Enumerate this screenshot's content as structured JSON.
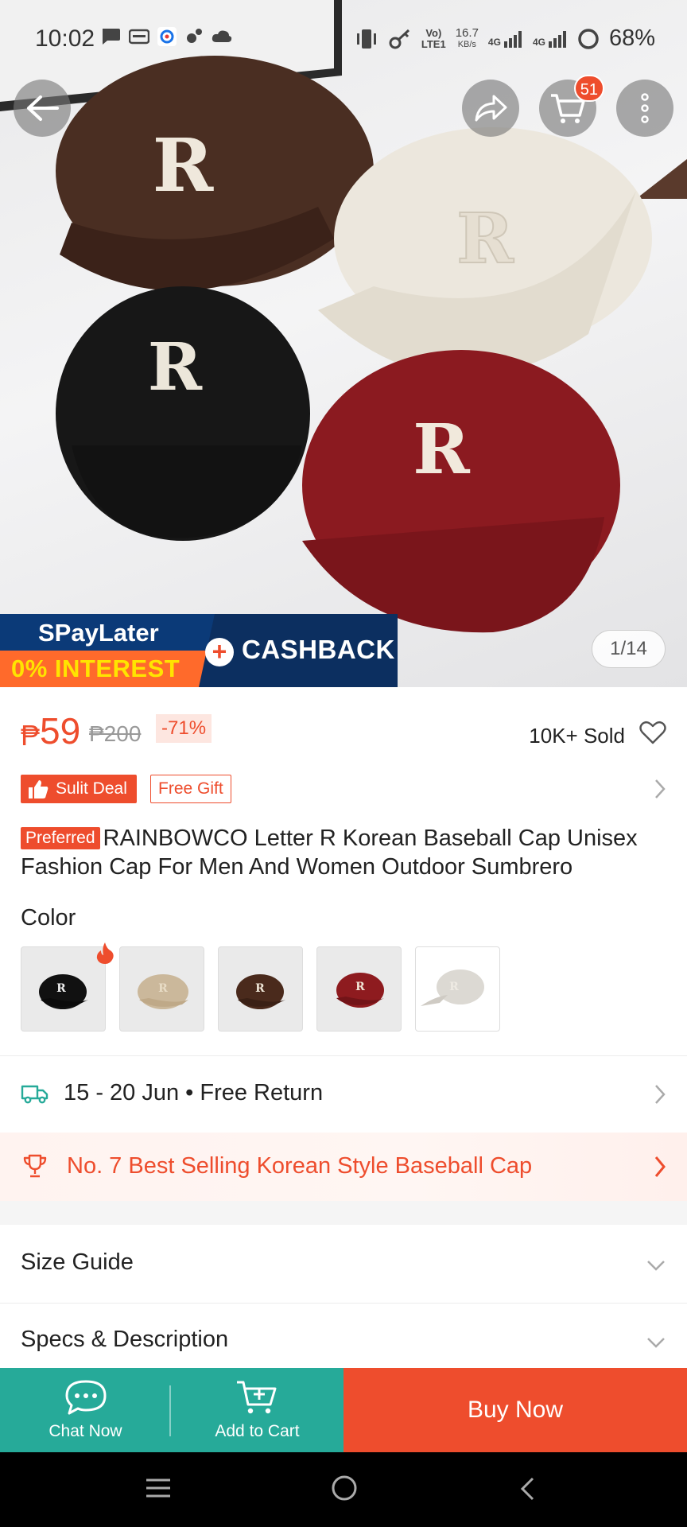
{
  "status_bar": {
    "time": "10:02",
    "network_speed_value": "16.7",
    "network_speed_unit": "KB/s",
    "volte": "Vo)",
    "lte_label": "LTE1",
    "sim1_gen": "4G",
    "sim2_gen": "4G",
    "battery": "68%"
  },
  "header": {
    "cart_count": "51",
    "image_counter": "1/14"
  },
  "promo_banner": {
    "line1": "SPayLater",
    "line2": "0% INTEREST",
    "plus": "+",
    "cashback": "CASHBACK"
  },
  "price": {
    "currency": "₱",
    "current": "59",
    "original": "₱200",
    "discount": "-71%",
    "sold": "10K+ Sold"
  },
  "badges": {
    "sulit_deal": "Sulit Deal",
    "free_gift": "Free Gift"
  },
  "product": {
    "preferred_tag": "Preferred",
    "title": "RAINBOWCO Letter R Korean Baseball Cap Unisex Fashion Cap For Men And Women Outdoor Sumbrero"
  },
  "variations": {
    "label": "Color",
    "options": [
      {
        "name": "black",
        "color": "#111111"
      },
      {
        "name": "khaki",
        "color": "#cbb89b"
      },
      {
        "name": "brown",
        "color": "#4a2a1c"
      },
      {
        "name": "red",
        "color": "#8e1b1f"
      },
      {
        "name": "light-gray",
        "color": "#dcd9d3"
      }
    ]
  },
  "delivery": {
    "text": "15 - 20 Jun • Free Return"
  },
  "ranking": {
    "text": "No. 7 Best Selling Korean Style Baseball Cap"
  },
  "sections": {
    "size_guide": "Size Guide",
    "specs": "Specs & Description"
  },
  "action_bar": {
    "chat": "Chat Now",
    "add_to_cart": "Add to Cart",
    "buy_now": "Buy Now"
  },
  "colors": {
    "accent": "#ee4d2d",
    "teal": "#26aa99"
  }
}
